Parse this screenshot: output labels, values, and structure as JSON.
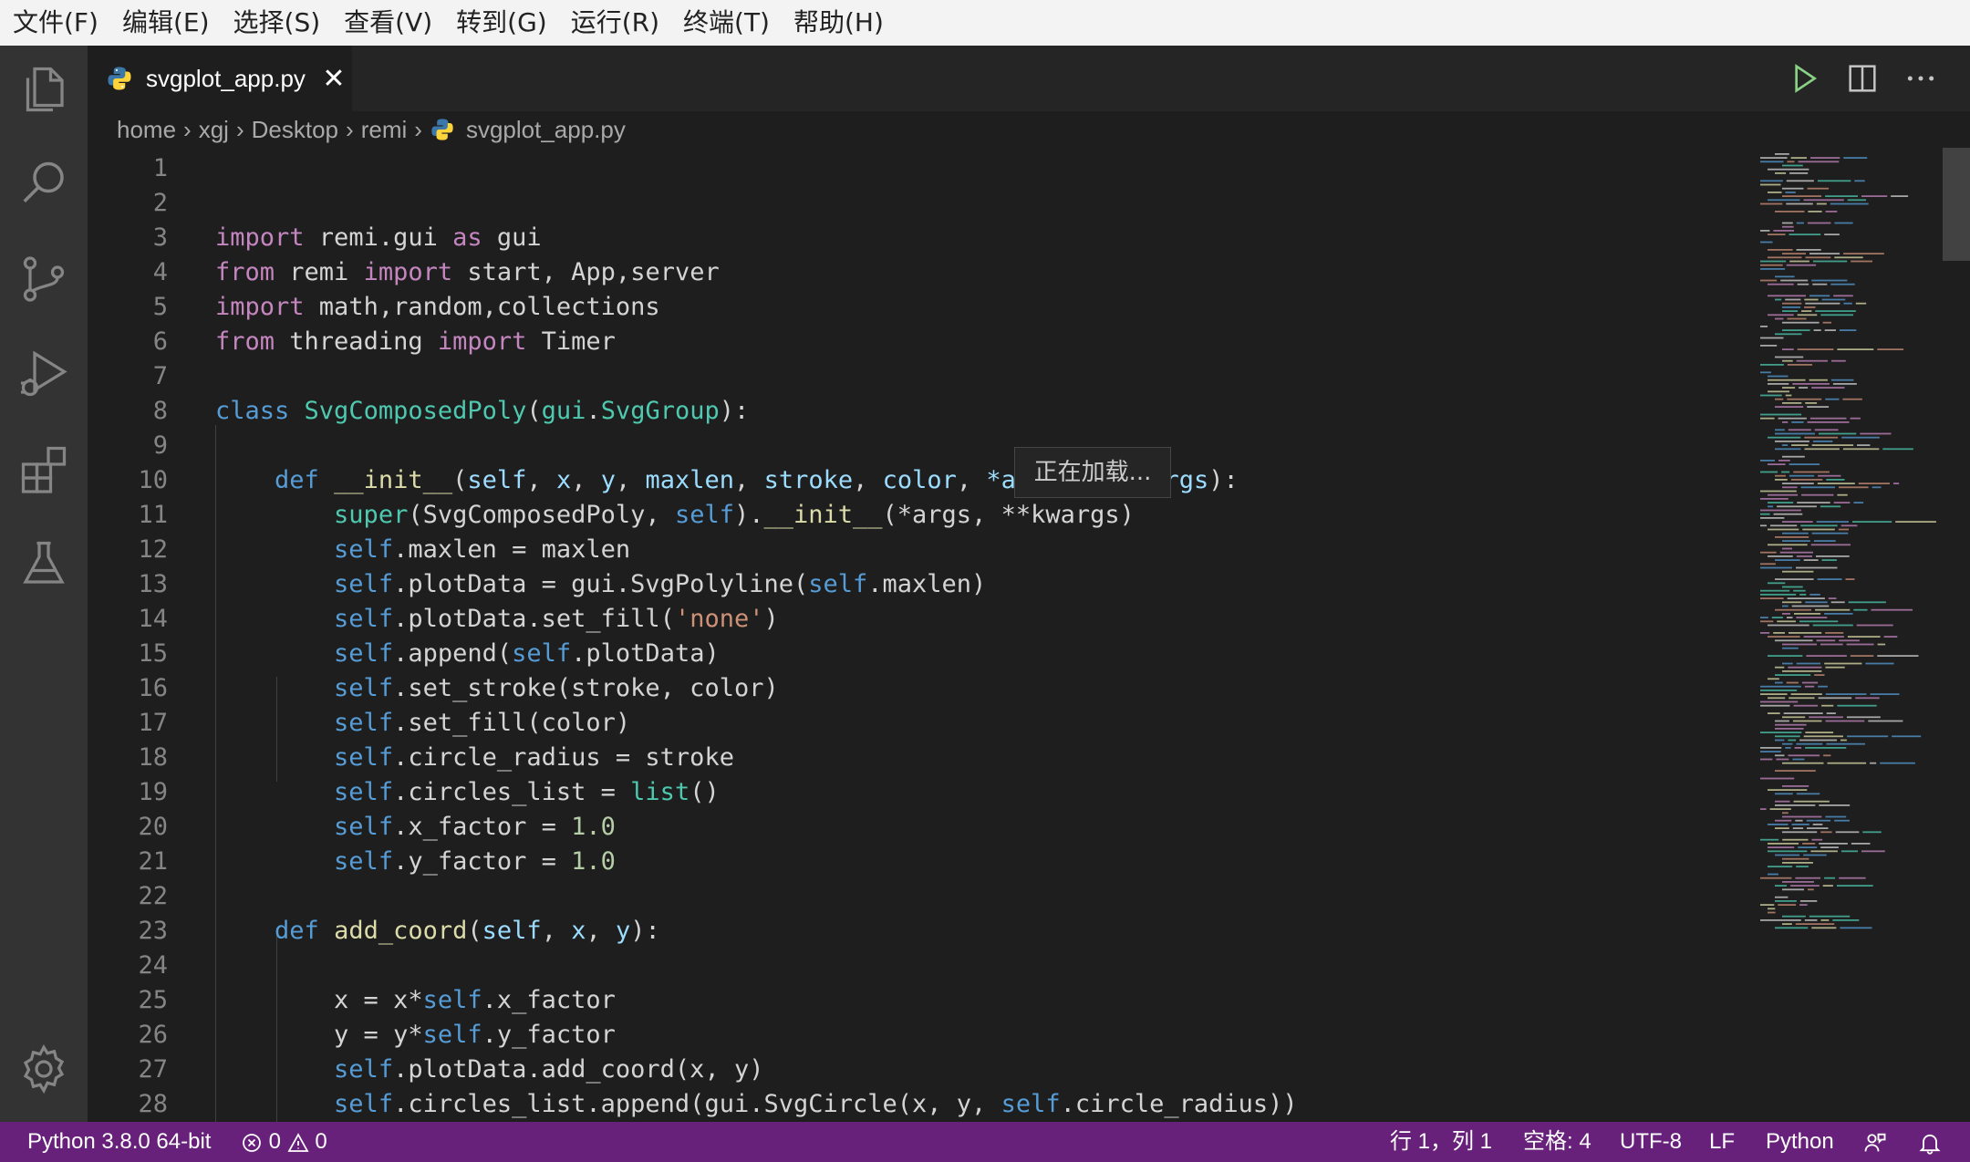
{
  "menu": [
    "文件(F)",
    "编辑(E)",
    "选择(S)",
    "查看(V)",
    "转到(G)",
    "运行(R)",
    "终端(T)",
    "帮助(H)"
  ],
  "activity_icons": [
    "explorer-icon",
    "search-icon",
    "source-control-icon",
    "run-debug-icon",
    "extensions-icon",
    "testing-icon",
    "settings-gear-icon"
  ],
  "tab": {
    "label": "svgplot_app.py",
    "close": "✕"
  },
  "tab_actions": [
    "run-icon",
    "split-editor-icon",
    "more-actions-icon"
  ],
  "breadcrumb": [
    "home",
    "xgj",
    "Desktop",
    "remi",
    "svgplot_app.py"
  ],
  "editor": {
    "line_numbers": [
      "1",
      "2",
      "3",
      "4",
      "5",
      "6",
      "7",
      "8",
      "9",
      "10",
      "11",
      "12",
      "13",
      "14",
      "15",
      "16",
      "17",
      "18",
      "19",
      "20",
      "21",
      "22",
      "23",
      "24",
      "25",
      "26",
      "27",
      "28"
    ],
    "tooltip": "正在加载..."
  },
  "status": {
    "interpreter": "Python 3.8.0 64-bit",
    "errors": "0",
    "warnings": "0",
    "cursor": "行 1，列 1",
    "indent": "空格: 4",
    "encoding": "UTF-8",
    "eol": "LF",
    "language": "Python"
  },
  "colors": {
    "status_bar": "#68217a",
    "activity_bar": "#333333",
    "editor_bg": "#1e1e1e",
    "keyword": "#c586c0",
    "storage": "#569cd6",
    "class": "#4ec9b0",
    "function": "#dcdcaa",
    "string": "#ce9178",
    "number": "#b5cea8"
  }
}
